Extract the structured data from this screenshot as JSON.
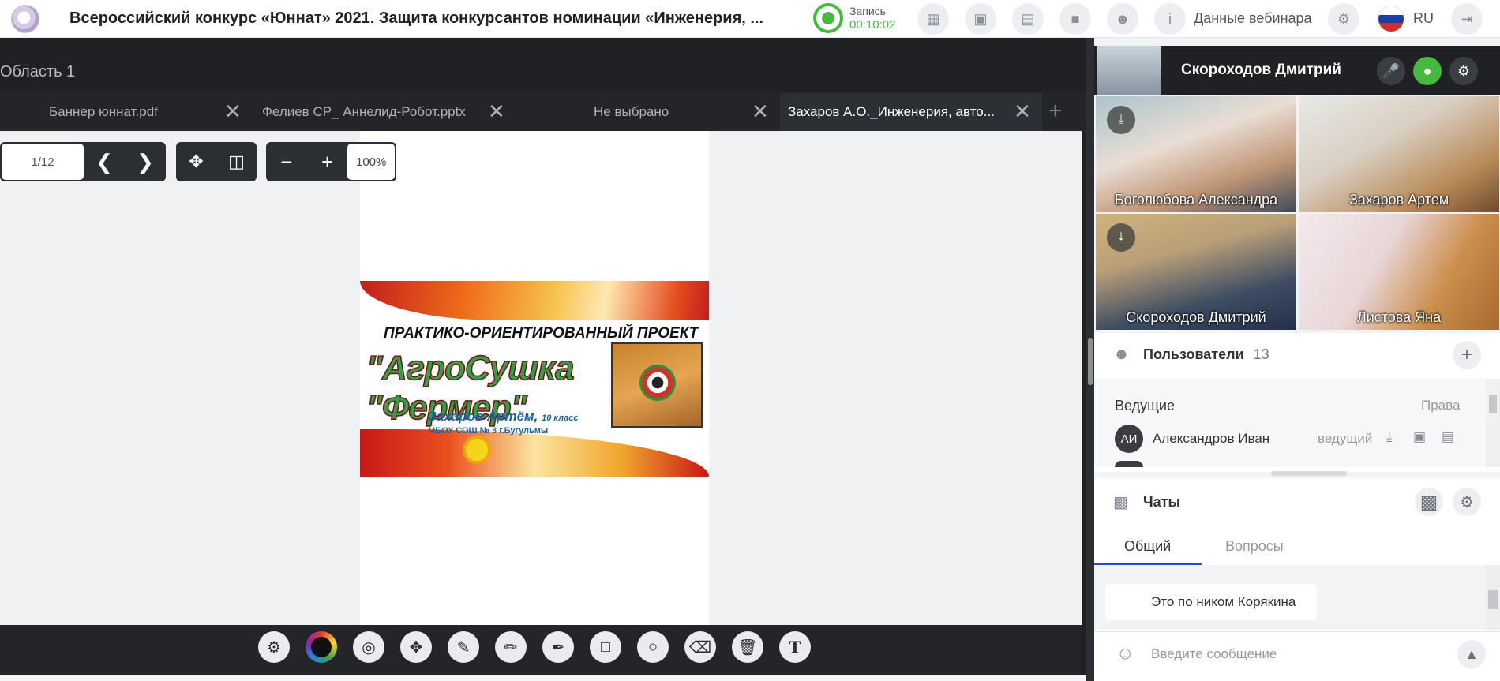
{
  "header": {
    "title": "Всероссийский конкурс «Юннат» 2021. Защита конкурсантов номинации «Инженерия, ...",
    "record_label": "Запись",
    "record_time": "00:10:02",
    "webinar_label": "Данные вебинара",
    "language": "RU"
  },
  "workspace": {
    "area_title": "Область 1",
    "tabs": [
      {
        "label": "Баннер юннат.pdf"
      },
      {
        "label": "Фелиев СР_ Аннелид-Робот.pptx"
      },
      {
        "label": "Не выбрано"
      },
      {
        "label": "Захаров А.О._Инженерия, авто..."
      }
    ],
    "pager": "1/12",
    "zoom": "100%"
  },
  "banner": {
    "heading": "ПРАКТИКО-ОРИЕНТИРОВАННЫЙ ПРОЕКТ",
    "main": "\"АгроСушка \"Фермер\"",
    "author": "Захаров Артём,",
    "grade": "10 класс",
    "school": "МБОУ СОШ № 3 г.Бугульмы"
  },
  "speaker": {
    "name": "Скороходов Дмитрий"
  },
  "videos": [
    {
      "name": "Боголюбова Александра",
      "muted": true
    },
    {
      "name": "Захаров Артем",
      "muted": false
    },
    {
      "name": "Скороходов Дмитрий",
      "muted": true
    },
    {
      "name": "Листова Яна",
      "muted": false
    }
  ],
  "users": {
    "title": "Пользователи",
    "count": "13",
    "section": "Ведущие",
    "rights_label": "Права",
    "rows": [
      {
        "initials": "АИ",
        "name": "Александров Иван",
        "role": "ведущий"
      }
    ]
  },
  "chats": {
    "title": "Чаты",
    "tabs": [
      {
        "label": "Общий"
      },
      {
        "label": "Вопросы"
      }
    ],
    "message": "Это по ником Корякина",
    "input_placeholder": "Введите сообщение"
  },
  "colors": {
    "accent_green": "#46b93f",
    "dark_bg": "#1f2124"
  }
}
